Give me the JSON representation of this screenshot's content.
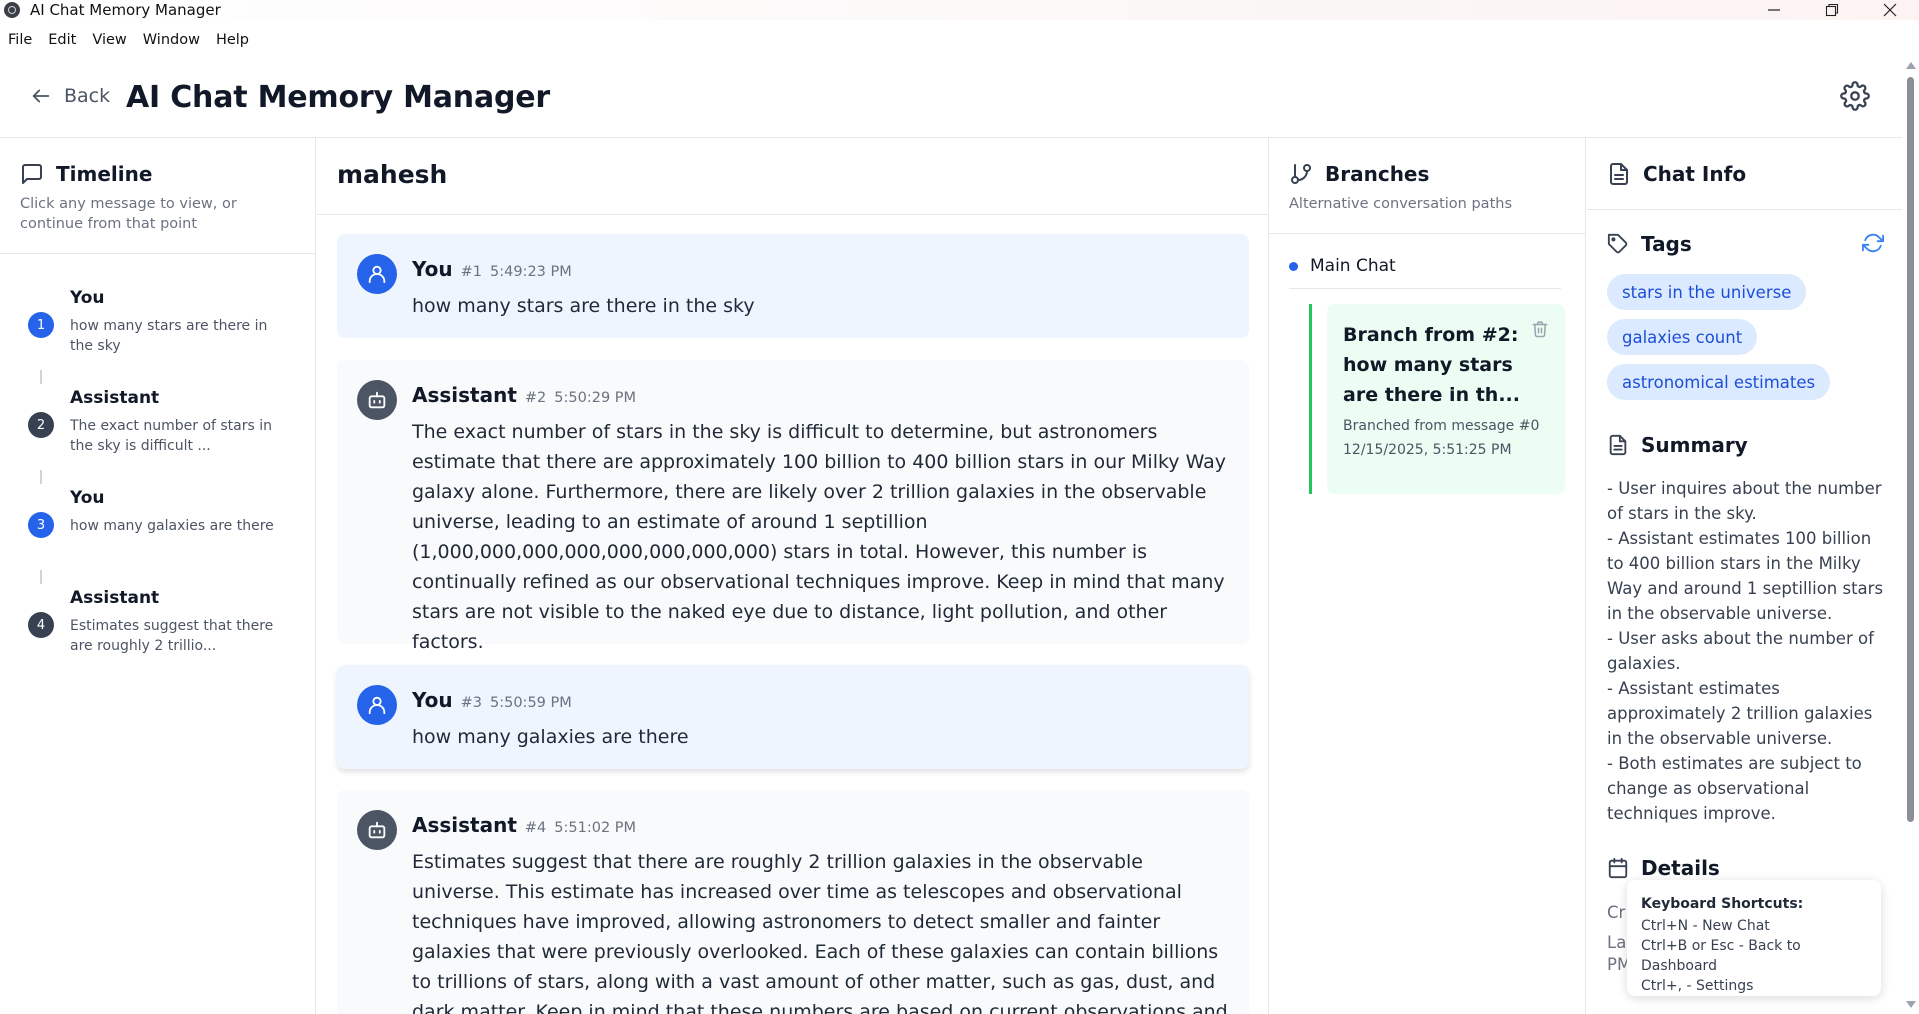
{
  "window": {
    "title": "AI Chat Memory Manager"
  },
  "menu": [
    "File",
    "Edit",
    "View",
    "Window",
    "Help"
  ],
  "header": {
    "back_label": "Back",
    "title": "AI Chat Memory Manager"
  },
  "timeline": {
    "title": "Timeline",
    "subtitle": "Click any message to view, or continue from that point",
    "items": [
      {
        "num": "1",
        "role": "You",
        "snippet": "how many stars are there in the sky",
        "kind": "user"
      },
      {
        "num": "2",
        "role": "Assistant",
        "snippet": "The exact number of stars in the sky is difficult ...",
        "kind": "bot"
      },
      {
        "num": "3",
        "role": "You",
        "snippet": "how many galaxies are there",
        "kind": "user"
      },
      {
        "num": "4",
        "role": "Assistant",
        "snippet": "Estimates suggest that there are roughly 2 trillio...",
        "kind": "bot"
      }
    ]
  },
  "chat": {
    "name": "mahesh",
    "messages": [
      {
        "role": "You",
        "num": "#1",
        "time": "5:49:23 PM",
        "text": "how many stars are there in the sky"
      },
      {
        "role": "Assistant",
        "num": "#2",
        "time": "5:50:29 PM",
        "text": "The exact number of stars in the sky is difficult to determine, but astronomers estimate that there are approximately 100 billion to 400 billion stars in our Milky Way galaxy alone. Furthermore, there are likely over 2 trillion galaxies in the observable universe, leading to an estimate of around 1 septillion (1,000,000,000,000,000,000,000,000) stars in total. However, this number is continually refined as our observational techniques improve. Keep in mind that many stars are not visible to the naked eye due to distance, light pollution, and other factors."
      },
      {
        "role": "You",
        "num": "#3",
        "time": "5:50:59 PM",
        "text": "how many galaxies are there"
      },
      {
        "role": "Assistant",
        "num": "#4",
        "time": "5:51:02 PM",
        "text": "Estimates suggest that there are roughly 2 trillion galaxies in the observable universe. This estimate has increased over time as telescopes and observational techniques have improved, allowing astronomers to detect smaller and fainter galaxies that were previously overlooked. Each of these galaxies can contain billions to trillions of stars, along with a vast amount of other matter, such as gas, dust, and dark matter. Keep in mind that these numbers are based on current observations and may change as our understanding of the"
      }
    ]
  },
  "branches": {
    "title": "Branches",
    "subtitle": "Alternative conversation paths",
    "main_label": "Main Chat",
    "card": {
      "title": "Branch from #2: how many stars are there in th...",
      "sub": "Branched from message #0",
      "date": "12/15/2025, 5:51:25 PM"
    }
  },
  "chatinfo": {
    "title": "Chat Info",
    "tags_title": "Tags",
    "tags": [
      "stars in the universe",
      "galaxies count",
      "astronomical estimates"
    ],
    "summary_title": "Summary",
    "summary": "- User inquires about the number of stars in the sky.\n- Assistant estimates 100 billion to 400 billion stars in the Milky Way and around 1 septillion stars in the observable universe.\n- User asks about the number of galaxies.\n- Assistant estimates approximately 2 trillion galaxies in the observable universe.\n- Both estimates are subject to change as observational techniques improve.",
    "details_title": "Details",
    "details_line1": "Cr",
    "details_line2": "La",
    "details_line3": "PM"
  },
  "tooltip": {
    "title": "Keyboard Shortcuts:",
    "lines": [
      "Ctrl+N - New Chat",
      "Ctrl+B or Esc - Back to Dashboard",
      "Ctrl+, - Settings"
    ]
  }
}
